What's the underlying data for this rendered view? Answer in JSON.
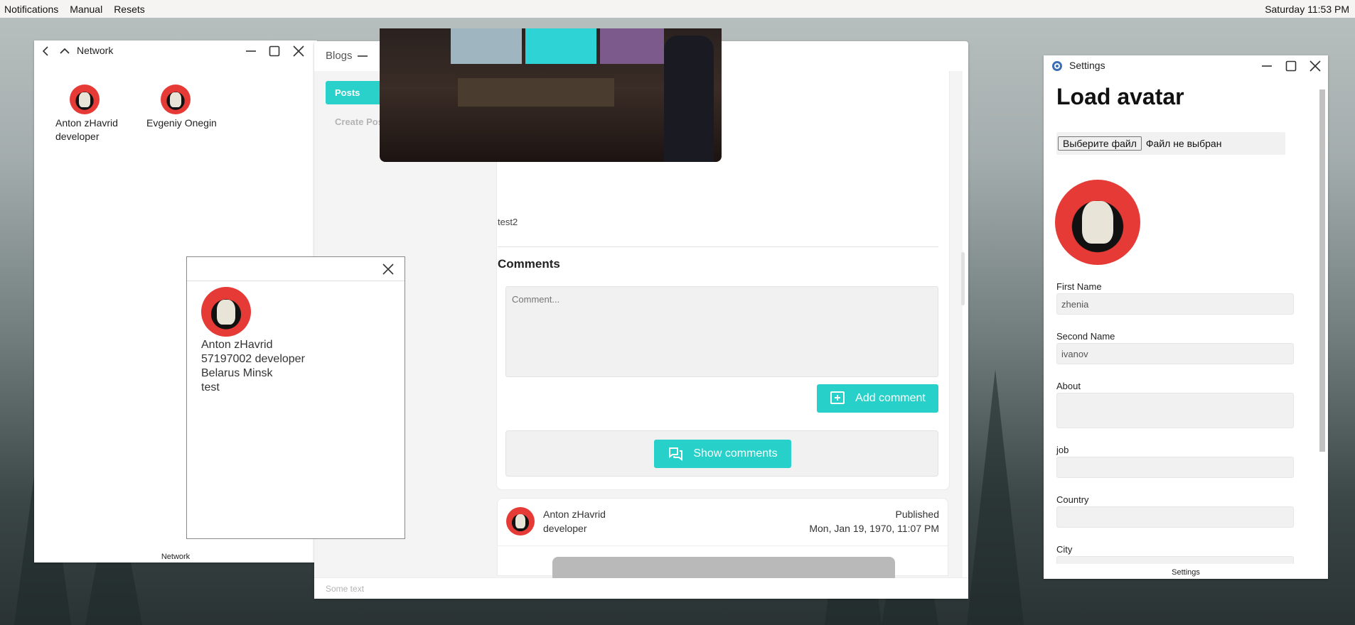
{
  "menubar": {
    "items": [
      "Notifications",
      "Manual",
      "Resets"
    ],
    "clock": "Saturday 11:53 PM"
  },
  "network": {
    "title": "Network",
    "status": "Network",
    "people": [
      {
        "name": "Anton zHavrid",
        "role": "developer"
      },
      {
        "name": "Evgeniy Onegin",
        "role": ""
      }
    ]
  },
  "profile": {
    "name": "Anton zHavrid",
    "job": "57197002 developer",
    "location": "Belarus Minsk",
    "about": "test"
  },
  "blogs": {
    "title": "Blogs",
    "nav": [
      "Posts",
      "Create Post"
    ],
    "caption": "test2",
    "comments_heading": "Comments",
    "comment_placeholder": "Comment...",
    "add_comment": "Add comment",
    "show_comments": "Show comments",
    "post2": {
      "author": "Anton zHavrid",
      "role": "developer",
      "published_label": "Published",
      "published_date": "Mon, Jan 19, 1970, 11:07 PM"
    },
    "footer": "Some text"
  },
  "settings": {
    "title": "Settings",
    "heading": "Load avatar",
    "file_button": "Выберите файл",
    "file_status": "Файл не выбран",
    "fields": {
      "first_name_label": "First Name",
      "first_name_value": "zhenia",
      "second_name_label": "Second Name",
      "second_name_value": "ivanov",
      "about_label": "About",
      "job_label": "job",
      "country_label": "Country",
      "city_label": "City"
    },
    "status": "Settings"
  },
  "colors": {
    "accent": "#27d0c8",
    "avatar_red": "#e53a36"
  }
}
